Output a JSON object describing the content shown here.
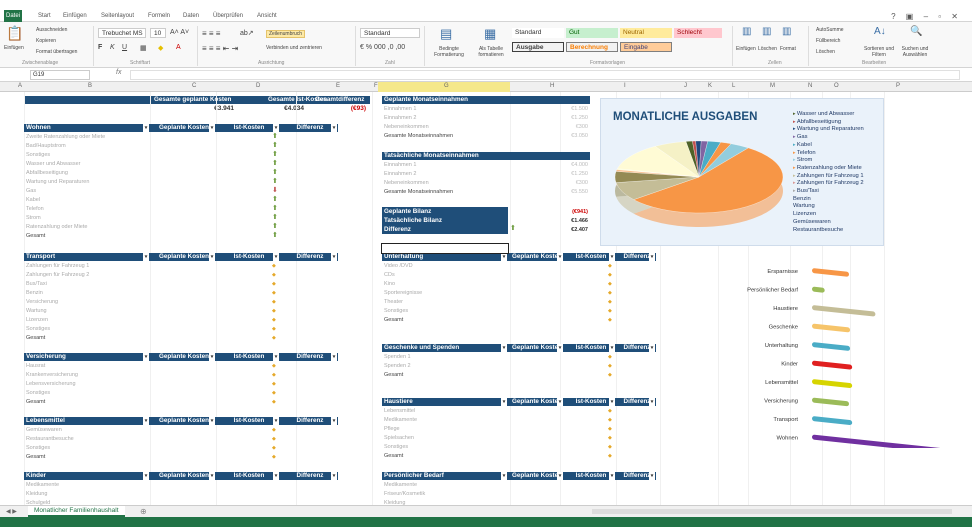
{
  "colors": {
    "green": "#217346",
    "navy": "#1f4e79"
  },
  "ribbon": {
    "file_tab": "Datei",
    "tabs": [
      "Start",
      "Einfügen",
      "Seitenlayout",
      "Formeln",
      "Daten",
      "Überprüfen",
      "Ansicht"
    ],
    "clipboard": {
      "cut": "Ausschneiden",
      "copy": "Kopieren",
      "painter": "Format übertragen",
      "paste": "Einfügen",
      "label": "Zwischenablage"
    },
    "font": {
      "name": "Trebuchet MS",
      "size": "10",
      "label": "Schriftart"
    },
    "alignment": {
      "wrap": "Zeilenumbruch",
      "merge": "Verbinden und zentrieren",
      "label": "Ausrichtung"
    },
    "number": {
      "format": "Standard",
      "label": "Zahl"
    },
    "cond_format": "Bedingte Formatierung",
    "as_table": "Als Tabelle formatieren",
    "styles": {
      "standard": "Standard",
      "gut": "Gut",
      "neutral": "Neutral",
      "schlecht": "Schlecht",
      "ausgabe": "Ausgabe",
      "berechnung": "Berechnung",
      "eingabe": "Eingabe",
      "label": "Formatvorlagen"
    },
    "cells": {
      "insert": "Einfügen",
      "delete": "Löschen",
      "format": "Format",
      "label": "Zellen"
    },
    "editing": {
      "autosum": "AutoSumme",
      "fill": "Füllbereich",
      "clear": "Löschen",
      "sort": "Sortieren und Filtern",
      "find": "Suchen und Auswählen",
      "label": "Bearbeiten"
    }
  },
  "formula_bar": {
    "cell": "G19",
    "fx": "fx"
  },
  "columns": [
    "A",
    "B",
    "C",
    "D",
    "E",
    "F",
    "G",
    "H",
    "I",
    "J",
    "K",
    "L",
    "M",
    "N",
    "O",
    "P"
  ],
  "summary": {
    "h1": "Gesamte geplante Kosten",
    "h2": "Gesamte Ist-Kosten",
    "h3": "Gesamtdifferenz",
    "v1": "€3.941",
    "v2": "€4.034",
    "v3": "(€93)"
  },
  "cols": {
    "geplant": "Geplante Kosten",
    "ist": "Ist-Kosten",
    "diff": "Differenz"
  },
  "wohnen": {
    "title": "Wohnen",
    "rows": [
      "Zweite Ratenzahlung oder Miete",
      "Bad/Hauptstrom",
      "Sonstiges",
      "Wasser und Abwasser",
      "Abfallbeseitigung",
      "Wartung und Reparaturen",
      "Gas",
      "Kabel",
      "Telefon",
      "Strom",
      "Ratenzahlung oder Miete",
      "Gesamt"
    ]
  },
  "transport": {
    "title": "Transport",
    "rows": [
      "Zahlungen für Fahrzeug 1",
      "Zahlungen für Fahrzeug 2",
      "Bus/Taxi",
      "Benzin",
      "Versicherung",
      "Wartung",
      "Lizenzen",
      "Sonstiges",
      "Gesamt"
    ]
  },
  "versicherung": {
    "title": "Versicherung",
    "rows": [
      "Hausrat",
      "Krankenversicherung",
      "Lebensversicherung",
      "Sonstiges",
      "Gesamt"
    ]
  },
  "lebensmittel": {
    "title": "Lebensmittel",
    "rows": [
      "Gemüsewaren",
      "Restaurantbesuche",
      "Sonstiges",
      "Gesamt"
    ]
  },
  "kinder": {
    "title": "Kinder",
    "rows": [
      "Medikamente",
      "Kleidung",
      "Schulgeld"
    ]
  },
  "planned_income": {
    "title": "Geplante Monatseinnahmen",
    "rows": [
      "Einnahmen 1",
      "Einnahmen 2",
      "Nebeneinkommen",
      "Gesamte Monatseinnahmen"
    ],
    "vals": [
      "€1.500",
      "€1.250",
      "€300",
      "€3.050"
    ]
  },
  "actual_income": {
    "title": "Tatsächliche Monatseinnahmen",
    "rows": [
      "Einnahmen 1",
      "Einnahmen 2",
      "Nebeneinkommen",
      "Gesamte Monatseinnahmen"
    ],
    "vals": [
      "€4.000",
      "€1.250",
      "€300",
      "€5.550"
    ]
  },
  "balance": {
    "planned": "Geplante Bilanz",
    "actual": "Tatsächliche Bilanz",
    "diff": "Differenz",
    "v_planned": "(€941)",
    "v_actual": "€1.466",
    "v_diff": "€2.407"
  },
  "unterhaltung": {
    "title": "Unterhaltung",
    "rows": [
      "Video /DVD",
      "CDs",
      "Kino",
      "Sportereignisse",
      "Theater",
      "Sonstiges",
      "Gesamt"
    ]
  },
  "geschenke": {
    "title": "Geschenke und Spenden",
    "rows": [
      "Spenden 1",
      "Spenden 2",
      "Gesamt"
    ]
  },
  "haustiere": {
    "title": "Haustiere",
    "rows": [
      "Lebensmittel",
      "Medikamente",
      "Pflege",
      "Spielsachen",
      "Sonstiges",
      "Gesamt"
    ]
  },
  "persoenlich": {
    "title": "Persönlicher Bedarf",
    "rows": [
      "Medikamente",
      "Friseur/Kosmetik",
      "Kleidung"
    ]
  },
  "pie": {
    "title": "MONATLICHE AUSGABEN",
    "legend": [
      "Wasser und Abwasser",
      "Abfallbeseitigung",
      "Wartung und Reparaturen",
      "Gas",
      "Kabel",
      "Telefon",
      "Strom",
      "Ratenzahlung oder Miete",
      "Zahlungen für Fahrzeug 1",
      "Zahlungen für Fahrzeug 2",
      "Bus/Taxi",
      "Benzin",
      "Wartung",
      "Lizenzen",
      "Gemüsewaren",
      "Restaurantbesuche"
    ]
  },
  "chart_data": [
    {
      "type": "pie",
      "title": "MONATLICHE AUSGABEN",
      "categories": [
        "Wasser und Abwasser",
        "Abfallbeseitigung",
        "Wartung und Reparaturen",
        "Gas",
        "Kabel",
        "Telefon",
        "Strom",
        "Ratenzahlung oder Miete",
        "Zahlungen für Fahrzeug 1",
        "Zahlungen für Fahrzeug 2",
        "Bus/Taxi",
        "Benzin",
        "Wartung",
        "Lizenzen",
        "Gemüsewaren",
        "Restaurantbesuche"
      ],
      "values": [
        30,
        15,
        25,
        30,
        60,
        50,
        90,
        1300,
        200,
        0,
        0,
        120,
        20,
        10,
        300,
        150
      ],
      "legend": "right"
    },
    {
      "type": "bar",
      "orientation": "horizontal",
      "categories": [
        "Ersparnisse",
        "Persönlicher Bedarf",
        "Haustiere",
        "Geschenke",
        "Unterhaltung",
        "Kinder",
        "Lebensmittel",
        "Versicherung",
        "Transport",
        "Wohnen"
      ],
      "values": [
        350,
        120,
        600,
        360,
        360,
        380,
        380,
        350,
        380,
        1300
      ],
      "xlim": [
        0,
        1400
      ],
      "xticks": [
        0,
        200,
        400,
        600,
        800,
        1000,
        1200,
        1400
      ],
      "colors": [
        "#f79646",
        "#9bbb59",
        "#c4bd97",
        "#f6c46a",
        "#4aacc6",
        "#e02020",
        "#d6d400",
        "#9bbb59",
        "#4aacc6",
        "#7030a0"
      ]
    }
  ],
  "bar_chart": {
    "xtick_labels": [
      "0",
      "200",
      "400",
      "600",
      "800",
      "1000",
      "1200",
      "1400"
    ]
  },
  "sheet_tab": "Monatlicher Familienhaushalt"
}
